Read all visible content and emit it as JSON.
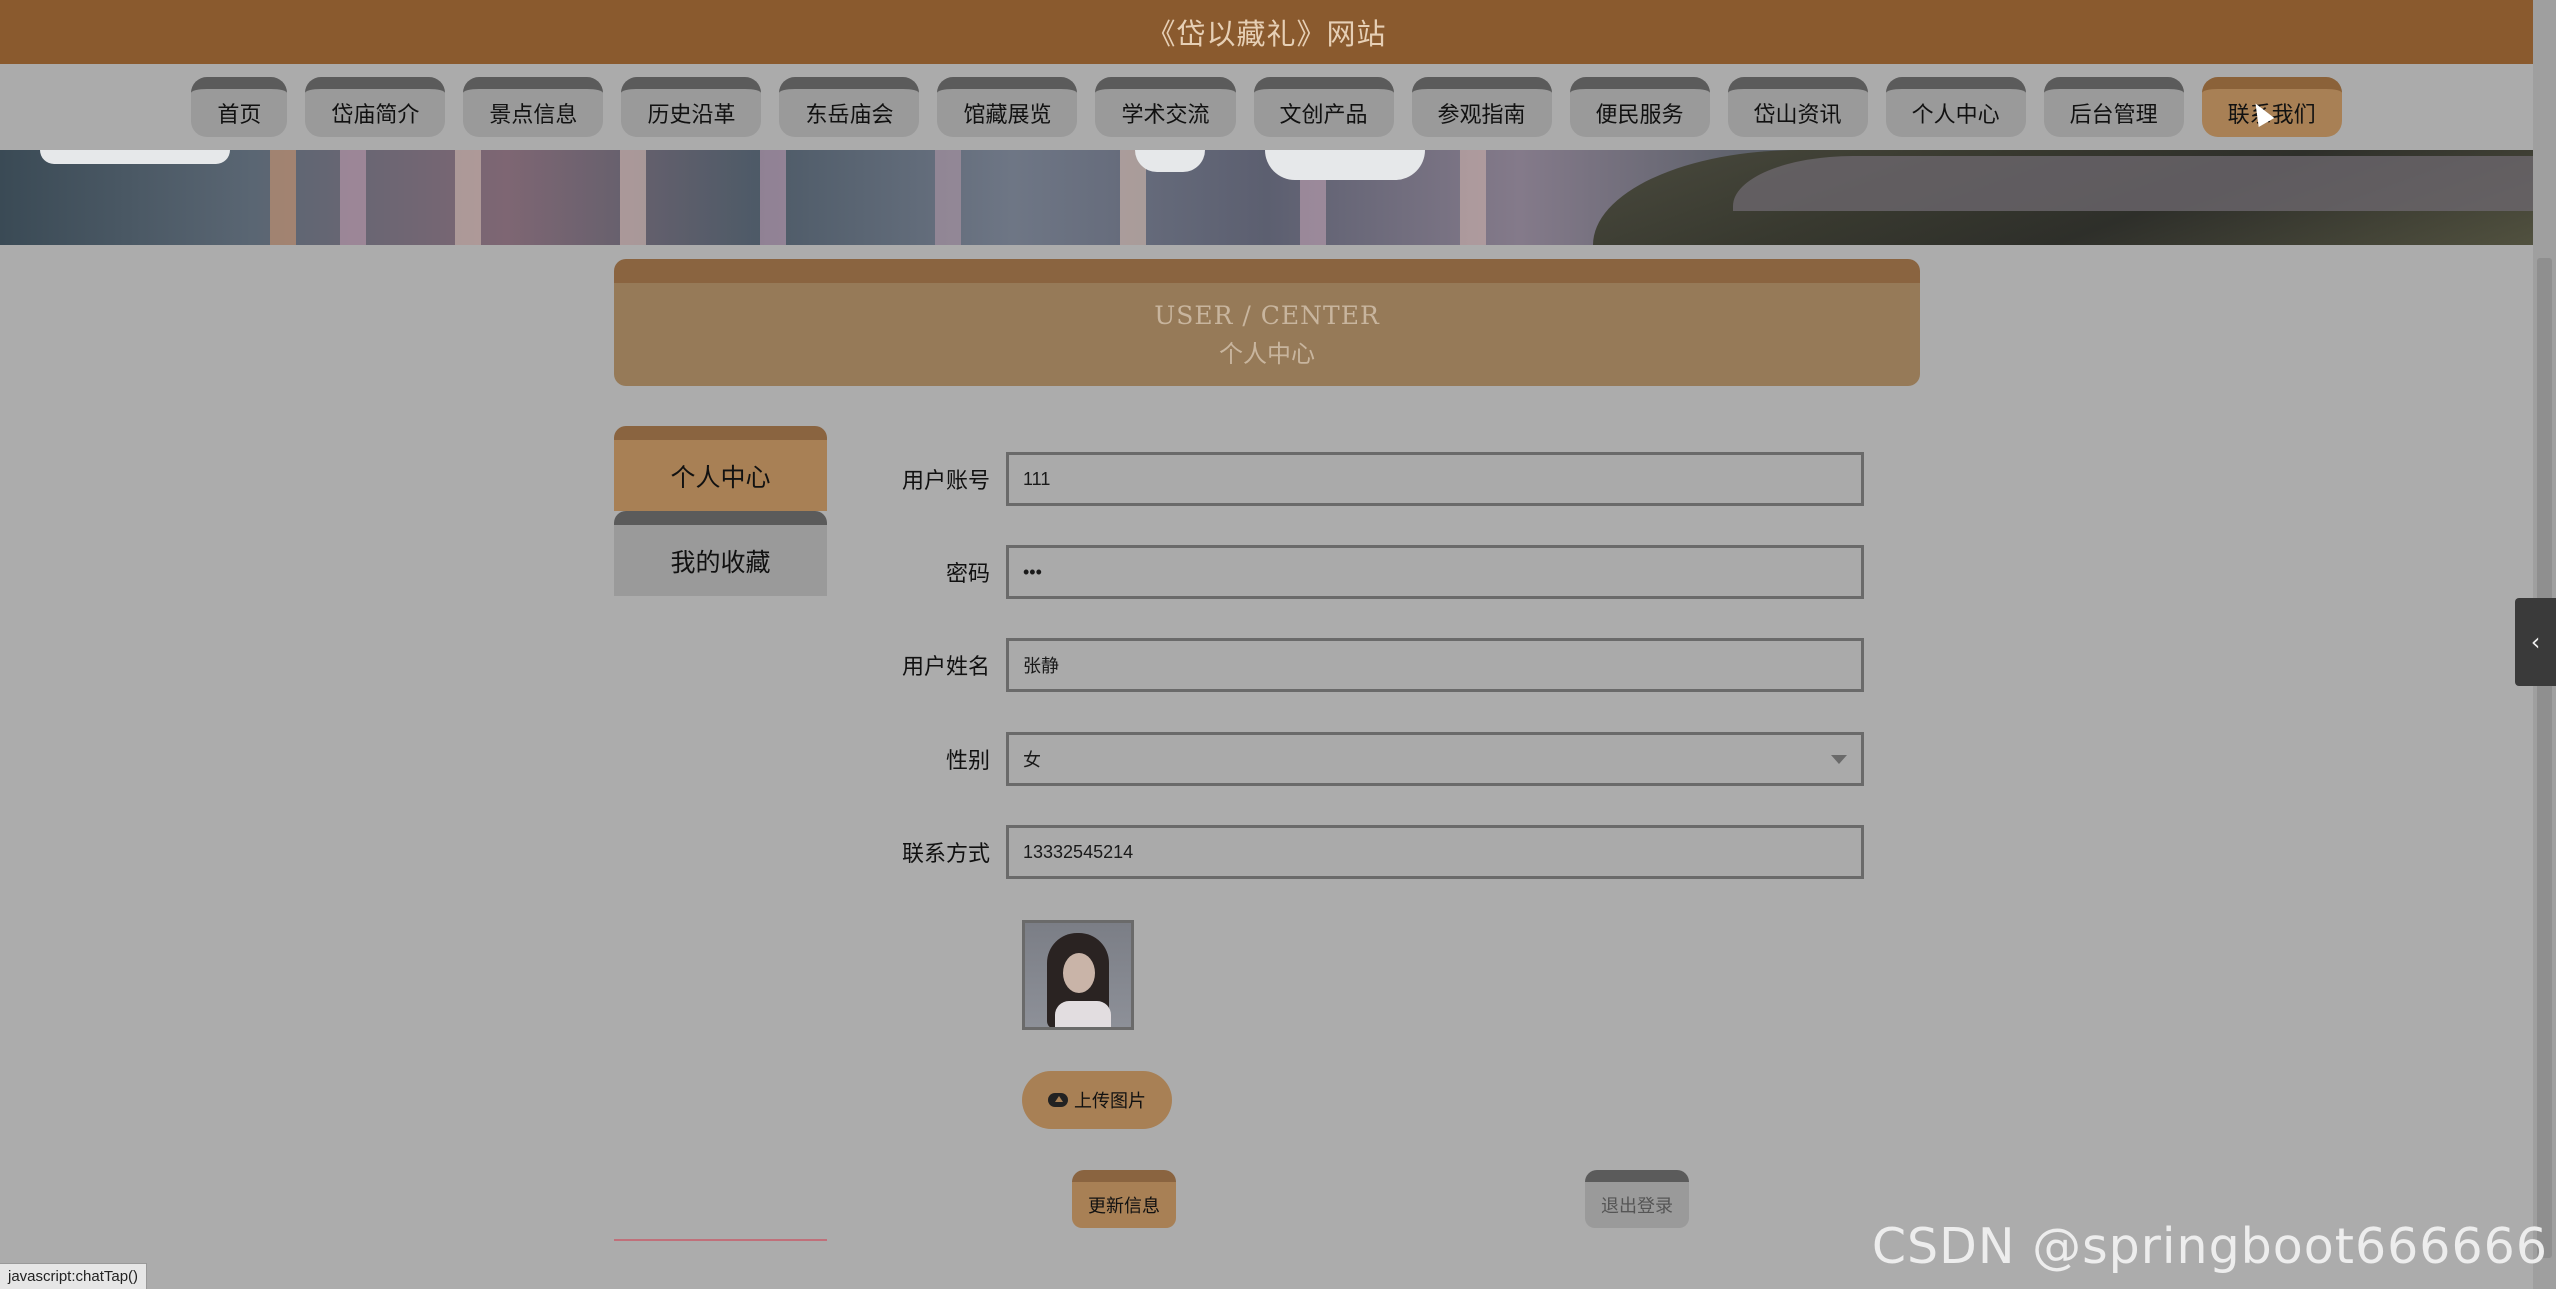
{
  "site": {
    "title": "《岱以藏礼》网站"
  },
  "nav": {
    "items": [
      "首页",
      "岱庙简介",
      "景点信息",
      "历史沿革",
      "东岳庙会",
      "馆藏展览",
      "学术交流",
      "文创产品",
      "参观指南",
      "便民服务",
      "岱山资讯",
      "个人中心",
      "后台管理",
      "联系我们"
    ],
    "active_index": 13
  },
  "header_panel": {
    "en": "USER / CENTER",
    "cn": "个人中心"
  },
  "side_menu": {
    "items": [
      "个人中心",
      "我的收藏"
    ]
  },
  "form": {
    "account_label": "用户账号",
    "account_value": "111",
    "password_label": "密码",
    "password_value": "•••",
    "name_label": "用户姓名",
    "name_value": "张静",
    "gender_label": "性别",
    "gender_value": "女",
    "contact_label": "联系方式",
    "contact_value": "13332545214"
  },
  "buttons": {
    "upload": "上传图片",
    "update": "更新信息",
    "logout": "退出登录"
  },
  "icons": {
    "upload": "cloud-upload-icon",
    "toggle": "chevron-left-icon"
  },
  "colors": {
    "brand": "#8a5a2e",
    "accent": "#a88055",
    "background": "#acacac"
  },
  "watermark": "CSDN @springboot666666",
  "status_bar": "javascript:chatTap()"
}
